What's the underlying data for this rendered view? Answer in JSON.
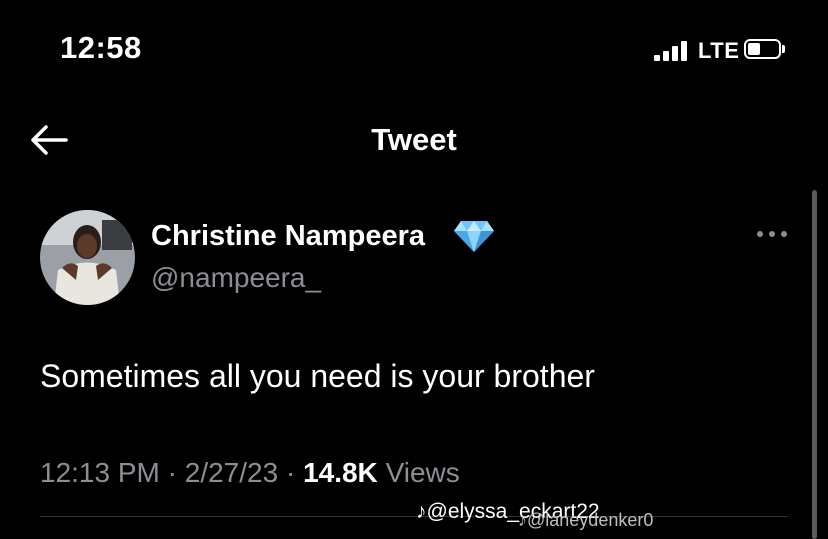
{
  "status_bar": {
    "time": "12:58",
    "network": "LTE",
    "signal_bars": 4,
    "battery_level": 0.3
  },
  "nav": {
    "title": "Tweet",
    "back_icon": "arrow-left-icon"
  },
  "tweet": {
    "author_name": "Christine Nampeera",
    "verified_icon": "blue-gem-icon",
    "handle": "@nampeera_",
    "text": "Sometimes all you need is your brother",
    "time": "12:13 PM",
    "date": "2/27/23",
    "views_count": "14.8K",
    "views_label": "Views",
    "separator": "·"
  },
  "watermarks": {
    "primary": "@elyssa_eckart22",
    "secondary": "@laneydenker0",
    "icon": "tiktok-icon"
  },
  "colors": {
    "background": "#000000",
    "secondary_text": "#8b8f94",
    "gem": "#6ec6ff"
  }
}
